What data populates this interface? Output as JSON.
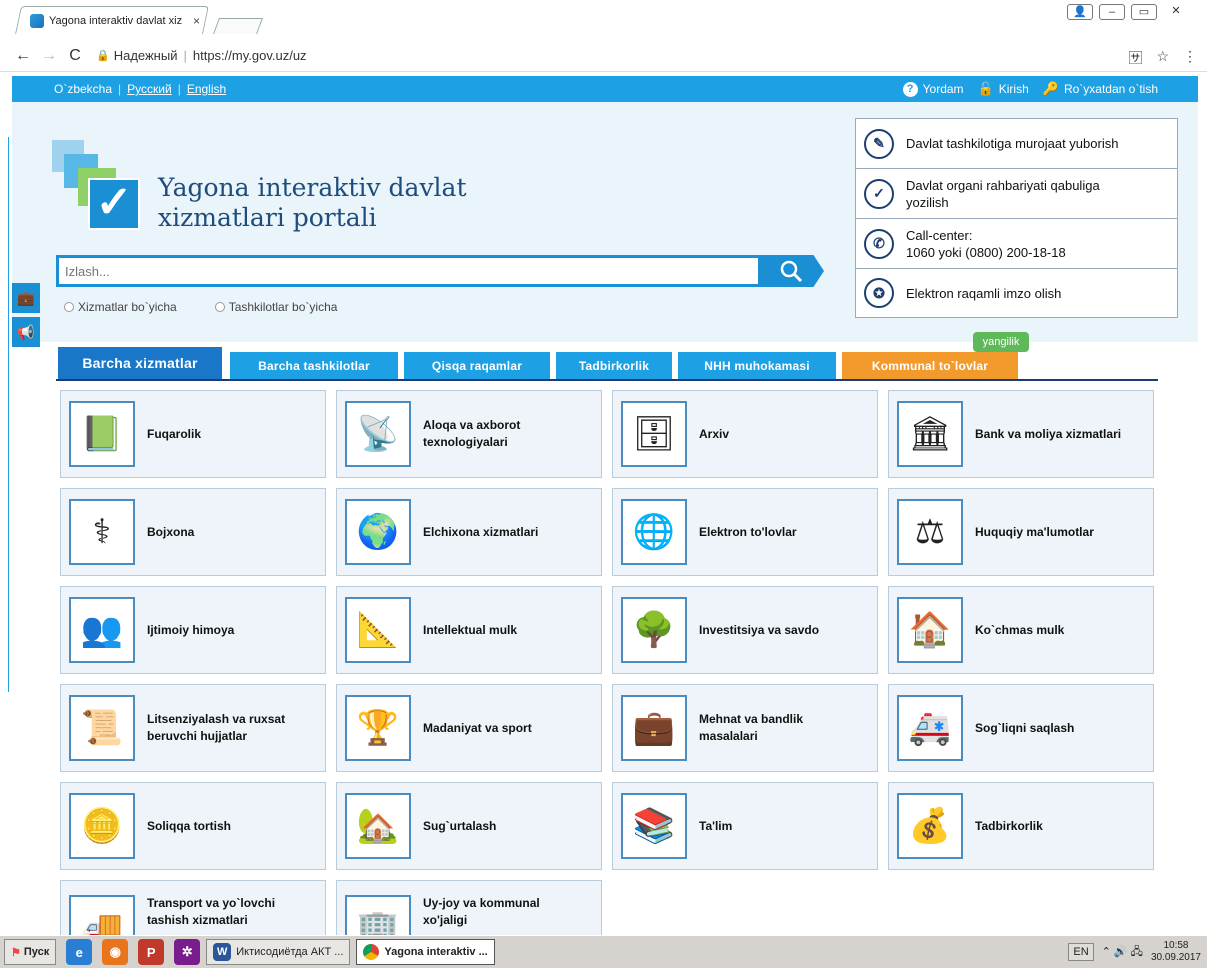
{
  "browser": {
    "tab_title": "Yagona interaktiv davlat xiz",
    "tab_close": "×",
    "secure_label": "Надежный",
    "url": "https://my.gov.uz/uz"
  },
  "topbar": {
    "langs": [
      "O`zbekcha",
      "Русский",
      "English"
    ],
    "help": "Yordam",
    "login": "Kirish",
    "register": "Ro`yxatdan o`tish"
  },
  "header": {
    "title_line1": "Yagona interaktiv davlat",
    "title_line2": "xizmatlari portali",
    "search_placeholder": "Izlash...",
    "radio_services": "Xizmatlar bo`yicha",
    "radio_orgs": "Tashkilotlar bo`yicha"
  },
  "info": [
    {
      "line1": "Davlat tashkilotiga murojaat yuborish",
      "line2": ""
    },
    {
      "line1": "Davlat organi rahbariyati qabuliga",
      "line2": "yozilish"
    },
    {
      "line1": "Call-center:",
      "line2": "1060 yoki (0800) 200-18-18"
    },
    {
      "line1": "Elektron raqamli imzo olish",
      "line2": ""
    }
  ],
  "tabs": {
    "badge": "yangilik",
    "items": [
      "Barcha xizmatlar",
      "Barcha tashkilotlar",
      "Qisqa raqamlar",
      "Tadbirkorlik",
      "NHH muhokamasi",
      "Kommunal to`lovlar"
    ]
  },
  "services": [
    {
      "line1": "Fuqarolik",
      "line2": "",
      "icon": "passport-icon"
    },
    {
      "line1": "Aloqa va axborot",
      "line2": "texnologiyalari",
      "icon": "satellite-dish-icon"
    },
    {
      "line1": "Arxiv",
      "line2": "",
      "icon": "archive-drawer-icon"
    },
    {
      "line1": "Bank va moliya xizmatlari",
      "line2": "",
      "icon": "bank-building-icon"
    },
    {
      "line1": "Bojxona",
      "line2": "",
      "icon": "caduceus-icon"
    },
    {
      "line1": "Elchixona xizmatlari",
      "line2": "",
      "icon": "globe-document-icon"
    },
    {
      "line1": "Elektron to'lovlar",
      "line2": "",
      "icon": "network-globe-icon"
    },
    {
      "line1": "Huquqiy ma'lumotlar",
      "line2": "",
      "icon": "scales-icon"
    },
    {
      "line1": "Ijtimoiy himoya",
      "line2": "",
      "icon": "people-shield-icon"
    },
    {
      "line1": "Intellektual mulk",
      "line2": "",
      "icon": "blueprint-pencil-icon"
    },
    {
      "line1": "Investitsiya va savdo",
      "line2": "",
      "icon": "money-tree-icon"
    },
    {
      "line1": "Ko`chmas mulk",
      "line2": "",
      "icon": "house-icon"
    },
    {
      "line1": "Litsenziyalash va ruxsat",
      "line2": "beruvchi hujjatlar",
      "icon": "certificate-icon"
    },
    {
      "line1": "Madaniyat va sport",
      "line2": "",
      "icon": "piano-trophy-icon"
    },
    {
      "line1": "Mehnat va bandlik",
      "line2": "masalalari",
      "icon": "briefcase-icon"
    },
    {
      "line1": "Sog`liqni saqlash",
      "line2": "",
      "icon": "ambulance-icon"
    },
    {
      "line1": "Soliqqa tortish",
      "line2": "",
      "icon": "coins-icon"
    },
    {
      "line1": "Sug`urtalash",
      "line2": "",
      "icon": "house-hand-icon"
    },
    {
      "line1": "Ta'lim",
      "line2": "",
      "icon": "books-icon"
    },
    {
      "line1": "Tadbirkorlik",
      "line2": "",
      "icon": "business-money-icon"
    },
    {
      "line1": "Transport va yo`lovchi",
      "line2": "tashish xizmatlari",
      "icon": "truck-icon"
    },
    {
      "line1": "Uy-joy va kommunal",
      "line2": "xo'jaligi",
      "icon": "apartment-icon"
    }
  ],
  "taskbar": {
    "start": "Пуск",
    "task1": "Иктисодиётда АКТ ...",
    "task2": "Yagona interaktiv ...",
    "lang": "EN",
    "time": "10:58",
    "date": "30.09.2017"
  }
}
